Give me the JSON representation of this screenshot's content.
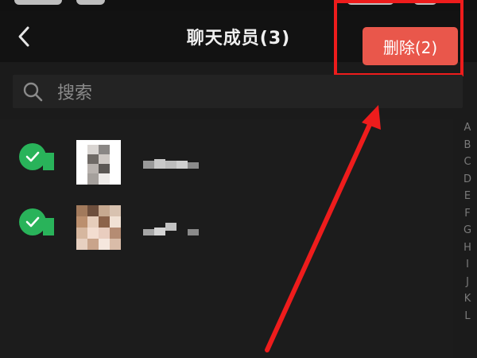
{
  "header": {
    "title": "聊天成员(3)",
    "delete_label": "删除(2)"
  },
  "search": {
    "placeholder": "搜索"
  },
  "members": [
    {
      "checked": true
    },
    {
      "checked": true
    }
  ],
  "alphabet_index": [
    "A",
    "B",
    "C",
    "D",
    "E",
    "F",
    "G",
    "H",
    "I",
    "J",
    "K",
    "L"
  ],
  "colors": {
    "accent_delete": "#e9574b",
    "check_green": "#29b35a",
    "annotation_red": "#ee1c1c",
    "background": "#1b1b1b"
  },
  "icons": {
    "back": "chevron-left-icon",
    "search": "search-icon",
    "check": "checkmark-icon"
  }
}
